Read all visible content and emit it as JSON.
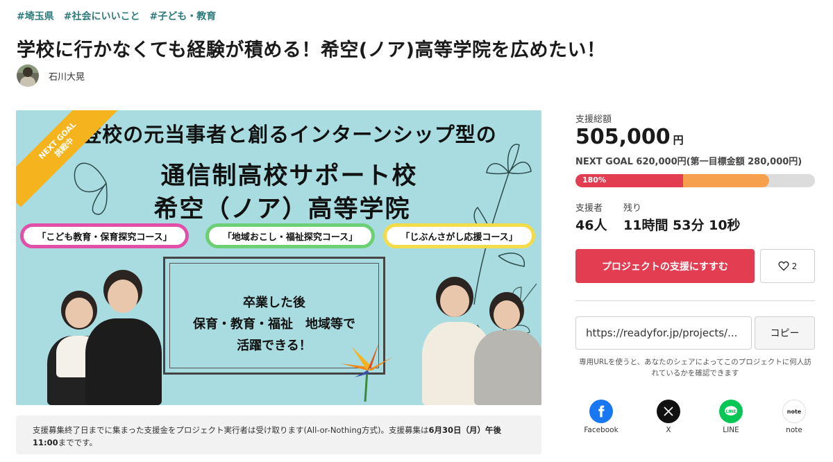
{
  "tags": [
    "#埼玉県",
    "#社会にいいこと",
    "#子ども・教育"
  ],
  "title": "学校に行かなくても経験が積める！希空(ノア)高等学院を広めたい！",
  "owner": {
    "name": "石川大晃"
  },
  "hero": {
    "line1": "不登校の元当事者と創るインターンシップ型の",
    "line2": "通信制高校サポート校",
    "line3": "希空（ノア）高等学院",
    "courses": [
      "「こども教育・保育探究コース」",
      "「地域おこし・福祉探究コース」",
      "「じぶんさがし応援コース」"
    ],
    "center_lines": [
      "卒業した後",
      "保育・教育・福祉　地域等で",
      "活躍できる！"
    ],
    "ribbon_top": "NEXT GOAL",
    "ribbon_bottom": "挑戦中"
  },
  "notice": {
    "text": "支援募集終了日までに集まった支援金をプロジェクト実行者は受け取ります(All-or-Nothing方式)。支援募集は",
    "bold": "6月30日（月）午後11:00",
    "suffix": "までです。"
  },
  "stats": {
    "total_label": "支援総額",
    "total_amount": "505,000",
    "total_unit": "円",
    "next_goal": "NEXT GOAL 620,000円(第一目標金額 280,000円)",
    "progress_label": "180%",
    "progress_main": 0.45,
    "progress_light": 0.81,
    "supporters_label": "支援者",
    "supporters_value": "46人",
    "remaining_label": "残り",
    "remaining_value": "11時間 53分 10秒"
  },
  "actions": {
    "support_label": "プロジェクトの支援にすすむ",
    "favorite_count": "2",
    "url_value": "https://readyfor.jp/projects/...",
    "copy_label": "コピー",
    "url_note": "専用URLを使うと、あなたのシェアによってこのプロジェクトに何人訪れているかを確認できます"
  },
  "share": [
    {
      "label": "Facebook",
      "icon": "facebook-icon",
      "color": "#1877f2"
    },
    {
      "label": "X",
      "icon": "x-icon",
      "color": "#111111"
    },
    {
      "label": "LINE",
      "icon": "line-icon",
      "color": "#06c755"
    },
    {
      "label": "note",
      "icon": "note-icon",
      "color": "#ffffff"
    }
  ]
}
